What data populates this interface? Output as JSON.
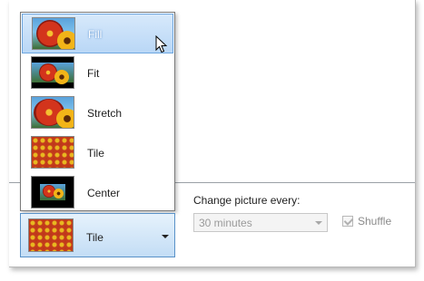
{
  "position": {
    "options": [
      {
        "label": "Fill",
        "selected": true
      },
      {
        "label": "Fit",
        "selected": false
      },
      {
        "label": "Stretch",
        "selected": false
      },
      {
        "label": "Tile",
        "selected": false
      },
      {
        "label": "Center",
        "selected": false
      }
    ],
    "current": "Tile"
  },
  "slideshow": {
    "change_label": "Change picture every:",
    "interval_value": "30 minutes",
    "shuffle_label": "Shuffle",
    "shuffle_checked": true
  },
  "colors": {
    "selection": "#b9d7f6",
    "selection_border": "#6fa7e0"
  }
}
